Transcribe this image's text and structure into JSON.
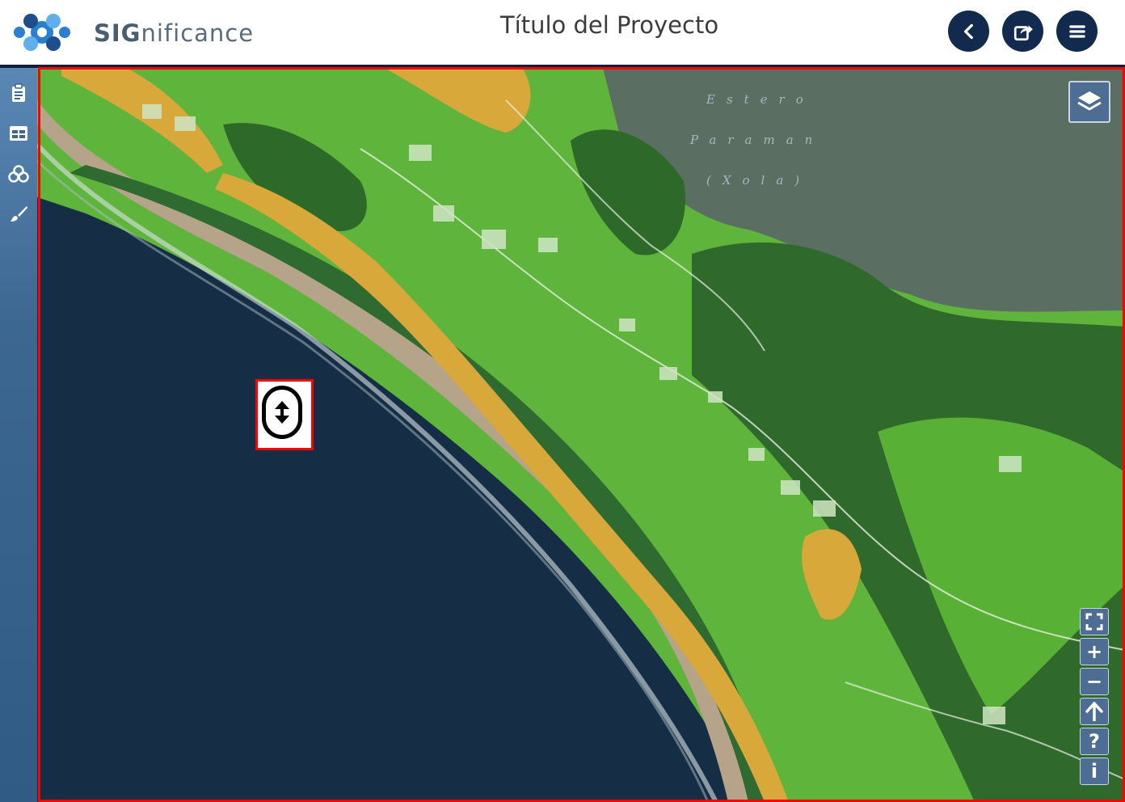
{
  "header": {
    "brand_bold": "SIG",
    "brand_rest": "nificance",
    "project_title": "Título del Proyecto",
    "buttons": [
      {
        "name": "back",
        "icon": "chevron-left-icon"
      },
      {
        "name": "share",
        "icon": "share-icon"
      },
      {
        "name": "menu",
        "icon": "hamburger-icon"
      }
    ]
  },
  "sidebar": {
    "items": [
      {
        "icon": "clipboard-icon"
      },
      {
        "icon": "table-icon"
      },
      {
        "icon": "layers-circles-icon"
      },
      {
        "icon": "brush-icon"
      }
    ]
  },
  "map": {
    "labels": [
      "Estero",
      "Paraman",
      "(Xola)"
    ],
    "controls": {
      "layers": "layers-icon",
      "zoom": [
        {
          "icon": "fullscreen-icon"
        },
        {
          "icon": "zoom-in-icon",
          "label": "+"
        },
        {
          "icon": "zoom-out-icon",
          "label": "−"
        },
        {
          "icon": "north-arrow-icon"
        },
        {
          "icon": "help-icon",
          "label": "?"
        },
        {
          "icon": "info-icon",
          "label": "i"
        }
      ]
    }
  },
  "colors": {
    "header_button": "#112a4d",
    "sidebar": "#3c6791",
    "ocean": "#14304a",
    "land_green": "#5fbf3a",
    "dark_green": "#2f6d2a",
    "orange_zone": "#d9a83a",
    "highlight": "#ff0000"
  }
}
